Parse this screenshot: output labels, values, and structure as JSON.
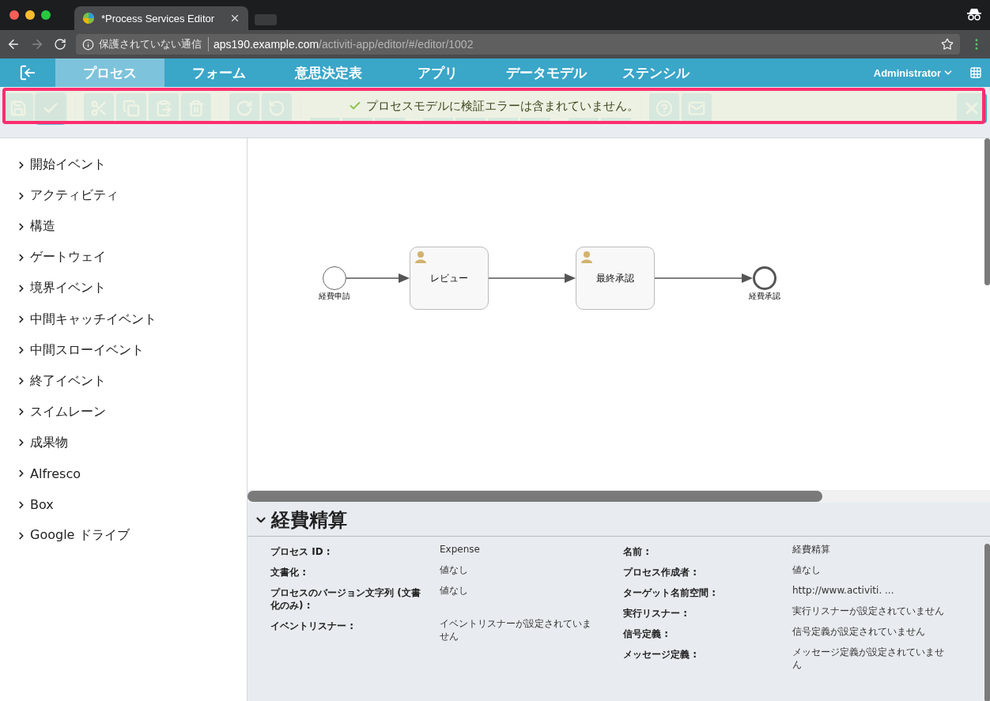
{
  "browser": {
    "tab_title": "*Process Services Editor",
    "security_label": "保護されていない通信",
    "url_host": "aps190.example.com",
    "url_path": "/activiti-app/editor/#/editor/1002"
  },
  "nav": {
    "items": [
      {
        "label": "プロセス",
        "selected": true
      },
      {
        "label": "フォーム",
        "selected": false
      },
      {
        "label": "意思決定表",
        "selected": false
      },
      {
        "label": "アプリ",
        "selected": false
      },
      {
        "label": "データモデル",
        "selected": false
      },
      {
        "label": "ステンシル",
        "selected": false
      }
    ],
    "user": "Administrator"
  },
  "notification": {
    "message": "プロセスモデルに検証エラーは含まれていません。"
  },
  "palette": {
    "groups": [
      {
        "label": "開始イベント",
        "expanded": false
      },
      {
        "label": "アクティビティ",
        "expanded": false
      },
      {
        "label": "構造",
        "expanded": false
      },
      {
        "label": "ゲートウェイ",
        "expanded": false
      },
      {
        "label": "境界イベント",
        "expanded": false
      },
      {
        "label": "中間キャッチイベント",
        "expanded": false
      },
      {
        "label": "中間スローイベント",
        "expanded": false
      },
      {
        "label": "終了イベント",
        "expanded": false
      },
      {
        "label": "スイムレーン",
        "expanded": false
      },
      {
        "label": "成果物",
        "expanded": false
      },
      {
        "label": "Alfresco",
        "expanded": false
      },
      {
        "label": "Box",
        "expanded": false
      },
      {
        "label": "Google ドライブ",
        "expanded": false
      }
    ]
  },
  "diagram": {
    "nodes": [
      {
        "kind": "start",
        "label": "経費申請"
      },
      {
        "kind": "user-task",
        "label": "レビュー"
      },
      {
        "kind": "user-task",
        "label": "最終承認"
      },
      {
        "kind": "end",
        "label": "経費承認"
      }
    ]
  },
  "properties": {
    "title": "経費精算",
    "expanded": true,
    "left": [
      {
        "label": "プロセス ID :",
        "value": "Expense"
      },
      {
        "label": "文書化 :",
        "value": "値なし"
      },
      {
        "label": "プロセスのバージョン文字列 (文書化のみ) :",
        "value": "値なし"
      },
      {
        "label": "イベントリスナー :",
        "value": "イベントリスナーが設定されていません"
      }
    ],
    "right": [
      {
        "label": "名前 :",
        "value": "経費精算"
      },
      {
        "label": "プロセス作成者 :",
        "value": "値なし"
      },
      {
        "label": "ターゲット名前空間 :",
        "value": "http://www.activiti. ..."
      },
      {
        "label": "実行リスナー :",
        "value": "実行リスナーが設定されていません"
      },
      {
        "label": "信号定義 :",
        "value": "信号定義が設定されていません"
      },
      {
        "label": "メッセージ定義 :",
        "value": "メッセージ定義が設定されていません"
      }
    ]
  }
}
